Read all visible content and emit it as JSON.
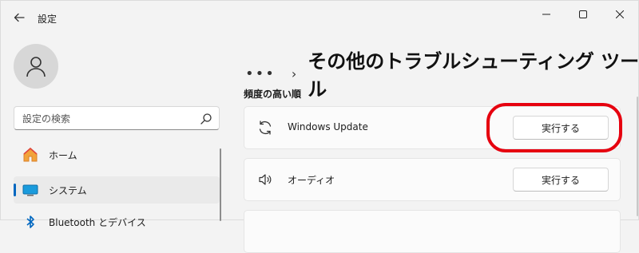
{
  "window": {
    "title": "設定",
    "controls": {
      "minimize": "—",
      "maximize": "☐",
      "close": "✕"
    }
  },
  "sidebar": {
    "search_placeholder": "設定の検索",
    "items": [
      {
        "label": "ホーム",
        "icon": "home-icon"
      },
      {
        "label": "システム",
        "icon": "system-monitor-icon",
        "active": true
      },
      {
        "label": "Bluetooth とデバイス",
        "icon": "bluetooth-icon"
      }
    ]
  },
  "main": {
    "breadcrumb_more": "•••",
    "breadcrumb_sep": "›",
    "page_title": "その他のトラブルシューティング ツール",
    "section_label": "頻度の高い順",
    "troubleshooters": [
      {
        "label": "Windows Update",
        "icon": "sync-icon",
        "button": "実行する",
        "highlighted": true
      },
      {
        "label": "オーディオ",
        "icon": "speaker-icon",
        "button": "実行する"
      }
    ]
  },
  "colors": {
    "accent": "#0067c0",
    "highlight": "#e6000f",
    "background": "#f3f3f3",
    "card": "#fbfbfb"
  }
}
